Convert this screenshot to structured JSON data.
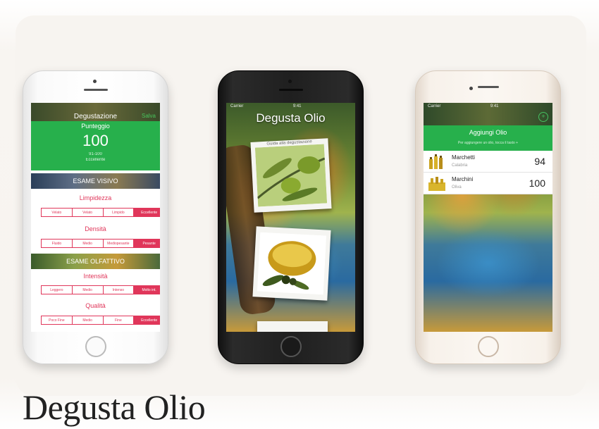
{
  "heading": "Degusta Olio",
  "phone1": {
    "nav_title": "Degustazione",
    "nav_back": "",
    "nav_save": "Salva",
    "score_label": "Punteggio",
    "score_value": "100",
    "score_sub1": "91-100",
    "score_sub2": "Eccellente",
    "section1": "ESAME VISIVO",
    "section2": "ESAME OLFATTIVO",
    "categories": [
      {
        "label": "Limpidezza",
        "options": [
          "Velato",
          "Velato",
          "Limpido",
          "Eccellente"
        ],
        "selected": 3
      },
      {
        "label": "Densità",
        "options": [
          "Fluido",
          "Medio",
          "Mediopesante",
          "Pesante"
        ],
        "selected": 3
      },
      {
        "label": "Intensità",
        "options": [
          "Leggero",
          "Medio",
          "Intenso",
          "Molto int."
        ],
        "selected": 3
      },
      {
        "label": "Qualità",
        "options": [
          "Poco Fine",
          "Medio",
          "Fine",
          "Eccellente"
        ],
        "selected": 3
      }
    ],
    "accent_color": "#27b04c",
    "selected_color": "#e0365a"
  },
  "phone2": {
    "status_carrier": "Carrier",
    "status_time": "9:41",
    "status_battery": "",
    "title": "Degusta Olio",
    "card1_caption": "Guida alla degustazione",
    "card2_caption": ""
  },
  "phone3": {
    "status_carrier": "Carrier",
    "status_time": "9:41",
    "status_battery": "",
    "title": "Aggiungi Olio",
    "subtitle": "Per aggiungere un olio, tocca il tasto +",
    "plus_icon": "+",
    "items": [
      {
        "name": "Marchetti",
        "region": "Calabria",
        "score": "94"
      },
      {
        "name": "Marchini",
        "region": "Oliva",
        "score": "100"
      }
    ]
  }
}
